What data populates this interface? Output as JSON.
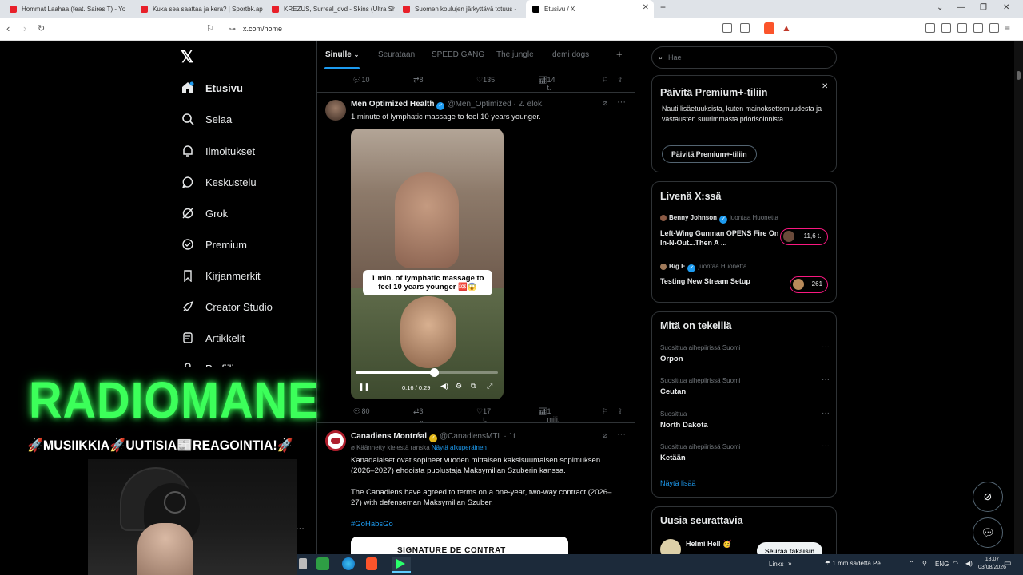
{
  "browser": {
    "tabs": [
      {
        "title": "Hommat Laahaa (feat. Saires T) - Yo",
        "icon": "youtube-icon"
      },
      {
        "title": "Kuka sea saattaa ja kera? | Sportbk.ap",
        "icon": "youtube-icon"
      },
      {
        "title": "KREZUS, Surreal_dvd - Skins (Ultra Sh",
        "icon": "youtube-icon"
      },
      {
        "title": "Suomen koulujen järkyttävä totuus -",
        "icon": "youtube-icon"
      },
      {
        "title": "Etusivu / X",
        "icon": "x-logo-icon",
        "active": true
      }
    ],
    "url": "x.com/home"
  },
  "sidebar": {
    "items": [
      {
        "label": "Etusivu",
        "icon": "home-icon"
      },
      {
        "label": "Selaa",
        "icon": "search-icon"
      },
      {
        "label": "Ilmoitukset",
        "icon": "bell-icon"
      },
      {
        "label": "Keskustelu",
        "icon": "chat-icon"
      },
      {
        "label": "Grok",
        "icon": "grok-icon"
      },
      {
        "label": "Premium",
        "icon": "premium-icon"
      },
      {
        "label": "Kirjanmerkit",
        "icon": "bookmark-icon"
      },
      {
        "label": "Creator Studio",
        "icon": "rocket-icon"
      },
      {
        "label": "Artikkelit",
        "icon": "article-icon"
      },
      {
        "label": "Profiili",
        "icon": "profile-icon"
      }
    ],
    "more": "..."
  },
  "timeline": {
    "tabs": [
      "Sinulle",
      "Seurataan",
      "SPEED GANG",
      "The jungle",
      "demi dogs"
    ],
    "add_tab": "+",
    "prev_actions": {
      "replies": "10",
      "reposts": "8",
      "likes": "135",
      "views": "14 t."
    },
    "tweet1": {
      "author": "Men Optimized Health",
      "handle": "@Men_Optimized",
      "time": "· 2. elok.",
      "text": "1 minute of lymphatic massage to feel 10 years younger.",
      "video_caption": "1 min. of lymphatic massage to feel 10 years younger 🆘😱",
      "video_time": "0:16 / 0:29",
      "video_progress": 0.55,
      "replies": "80",
      "reposts": "3 t.",
      "likes": "17 t.",
      "views": "1 milj."
    },
    "tweet2": {
      "author": "Canadiens Montréal",
      "handle": "@CanadiensMTL",
      "time": "· 1t",
      "translated_note": "Käännetty kielestä ranska",
      "show_original": "Näytä alkuperäinen",
      "text_fi": "Kanadalaiset ovat sopineet vuoden mittaisen kaksisuuntaisen sopimuksen (2026–2027) ehdoista puolustaja Maksymilian Szuberin kanssa.",
      "text_en": "The Canadiens have agreed to terms on a one-year, two-way contract (2026–27) with defenseman Maksymilian Szuber.",
      "hashtag": "#GoHabsGo",
      "image_text": "SIGNATURE DE CONTRAT"
    }
  },
  "right": {
    "search_placeholder": "Hae",
    "premium": {
      "title": "Päivitä Premium+-tiliin",
      "body": "Nauti lisäetuuksista, kuten mainoksettomuudesta ja vastausten suurimmasta priorisoinnista.",
      "button": "Päivitä Premium+-tiliin"
    },
    "live": {
      "title": "Livenä X:ssä",
      "items": [
        {
          "host": "Benny Johnson",
          "note": "juontaa Huonetta",
          "title": "Left-Wing Gunman OPENS Fire On In-N-Out...Then A ...",
          "count": "+11,6 t."
        },
        {
          "host": "Big E",
          "note": "juontaa Huonetta",
          "title": "Testing New Stream Setup",
          "count": "+261"
        }
      ]
    },
    "trends": {
      "title": "Mitä on tekeillä",
      "items": [
        {
          "category": "Suosittua aihepiirissä Suomi",
          "name": "Orpon"
        },
        {
          "category": "Suosittua aihepiirissä Suomi",
          "name": "Ceutan"
        },
        {
          "category": "Suosittua",
          "name": "North Dakota"
        },
        {
          "category": "Suosittua aihepiirissä Suomi",
          "name": "Ketään"
        }
      ],
      "show_more": "Näytä lisää"
    },
    "follow": {
      "title": "Uusia seurattavia",
      "name": "Helmi Hell 🥳",
      "button": "Seuraa takaisin"
    }
  },
  "overlay": {
    "title": "RADIOMANE",
    "subtitle": "🚀MUSIIKKIA🚀UUTISIA📰REAGOINTIA!🚀"
  },
  "taskbar": {
    "links": "Links",
    "weather": "1 mm sadetta Pe",
    "lang": "ENG",
    "time": "18.07",
    "date": "03/08/2026"
  },
  "colors": {
    "accent": "#1d9bf0",
    "overlay_green": "#3cff5a",
    "live_pink": "#f91880"
  }
}
